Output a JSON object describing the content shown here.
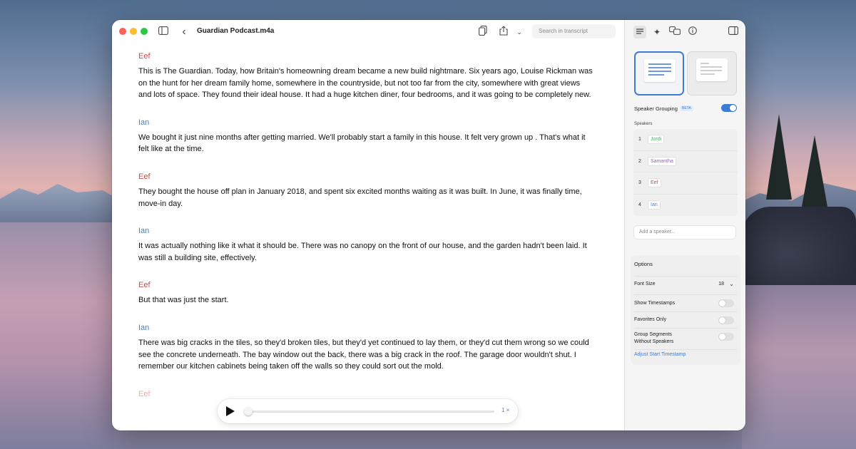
{
  "app": {
    "document_title": "Guardian Podcast.m4a",
    "search_placeholder": "Search in transcript"
  },
  "transcript": [
    {
      "speaker": "Eef",
      "text": "This is The Guardian. Today, how Britain's homeowning dream became a new build nightmare. Six years ago, Louise Rickman was on the hunt for her dream family home, somewhere in the countryside, but not too far from the city, somewhere with great views and lots of space. They found their ideal house. It had a huge kitchen diner, four bedrooms, and it was going to be completely new."
    },
    {
      "speaker": "Ian",
      "text": "We bought it just nine months after getting married. We'll probably start a family in this house. It felt very grown up . That's what it felt like at the time."
    },
    {
      "speaker": "Eef",
      "text": "They bought the house off plan in January 2018, and spent six excited months waiting as it was built. In June, it was finally time, move-in day."
    },
    {
      "speaker": "Ian",
      "text": "It was actually nothing like it what it should be. There was no canopy on the front of our house, and the garden hadn't been laid. It was still a building site, effectively."
    },
    {
      "speaker": "Eef",
      "text": "But that was just the start."
    },
    {
      "speaker": "Ian",
      "text": "There was big cracks in the tiles, so they'd broken tiles, but they'd yet continued to lay them, or they'd cut them wrong so we could see the concrete underneath. The bay window out the back, there was a big crack in the roof. The garage door wouldn't shut. I remember our kitchen cabinets being taken off the walls so they could sort out the mold."
    },
    {
      "speaker": "Eef",
      "text": ""
    }
  ],
  "player": {
    "speed": "1 ×",
    "progress": 0.0
  },
  "inspector": {
    "speaker_grouping_label": "Speaker Grouping",
    "beta_label": "BETA",
    "speaker_grouping_on": true,
    "speakers_heading": "Speakers",
    "speakers": [
      {
        "num": "1",
        "name": "Jordi",
        "color": "#5aa36a"
      },
      {
        "num": "2",
        "name": "Samantha",
        "color": "#9a5bc2"
      },
      {
        "num": "3",
        "name": "Eef",
        "color": "#c0504d"
      },
      {
        "num": "4",
        "name": "Ian",
        "color": "#4f82b8"
      }
    ],
    "add_speaker_placeholder": "Add a speaker...",
    "options_title": "Options",
    "font_size_label": "Font Size",
    "font_size_value": "18",
    "show_timestamps_label": "Show Timestamps",
    "show_timestamps_on": false,
    "favorites_only_label": "Favorites Only",
    "favorites_only_on": false,
    "group_segments_label_line1": "Group Segments",
    "group_segments_label_line2": "Without Speakers",
    "group_segments_on": false,
    "adjust_start_label": "Adjust Start Timestamp"
  },
  "colors": {
    "accent": "#3e7bd6",
    "speaker_eef": "#c0504d",
    "speaker_ian": "#4f82b8"
  }
}
